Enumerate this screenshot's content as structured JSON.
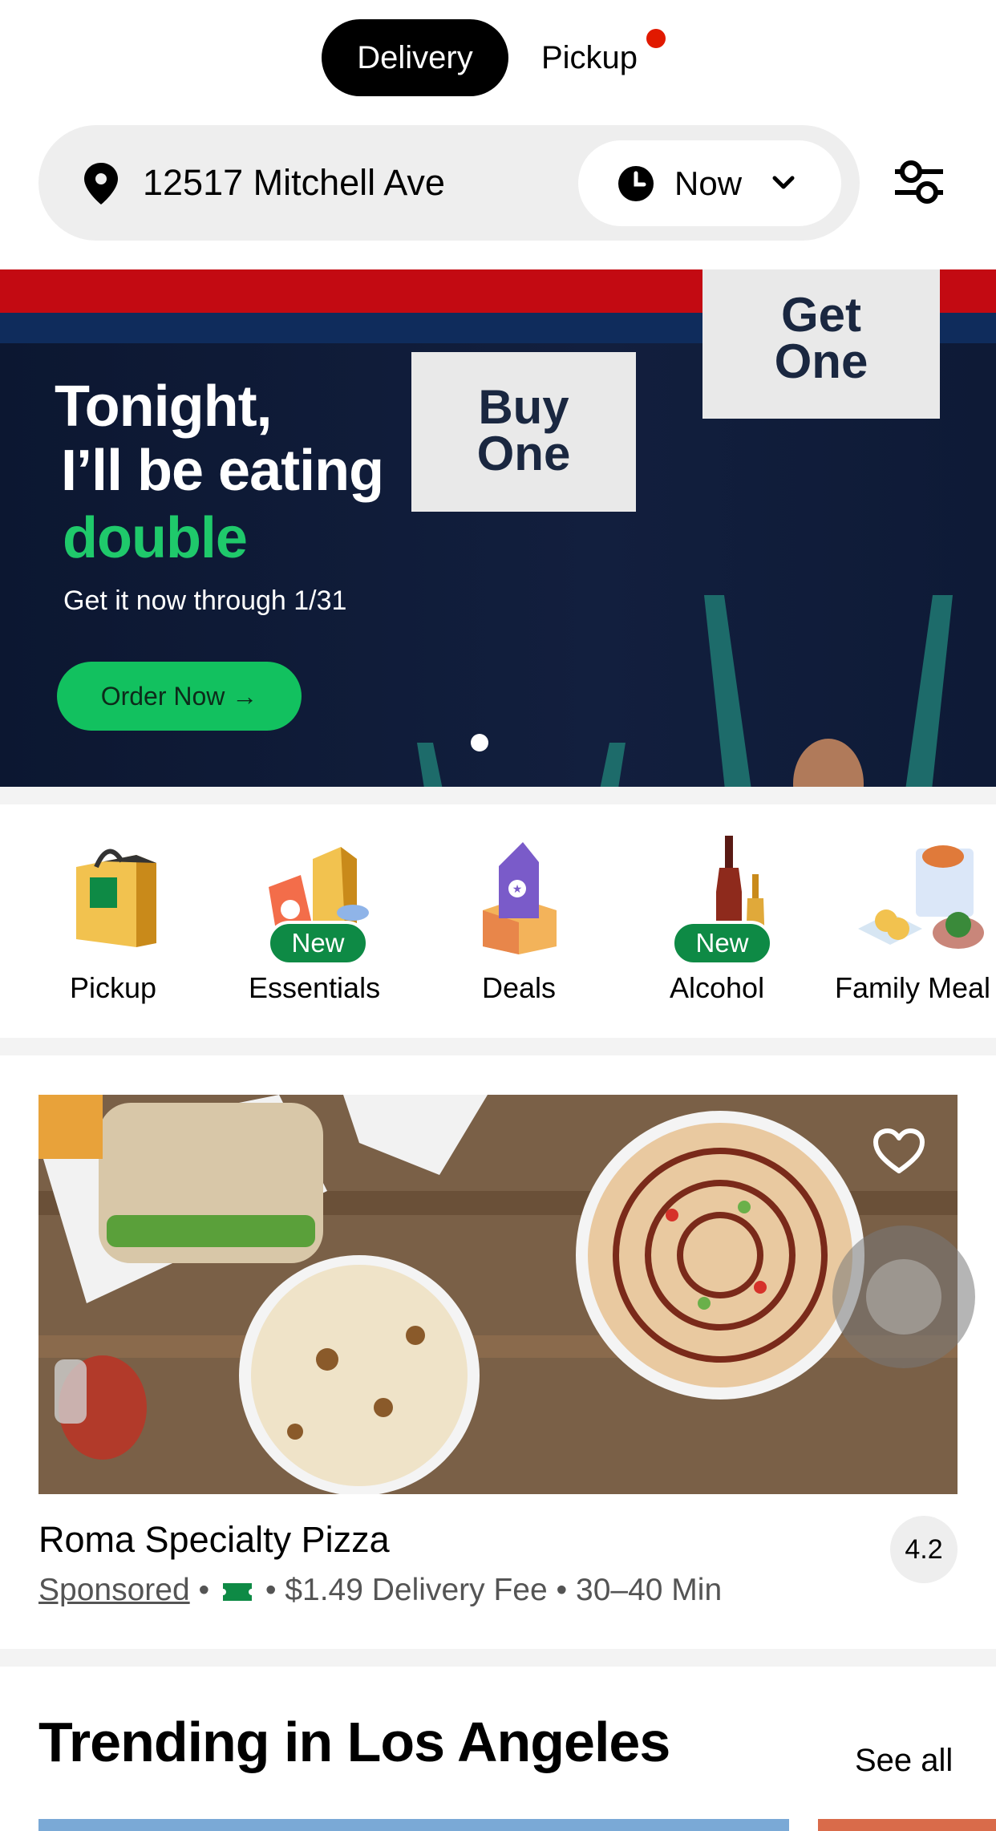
{
  "mode": {
    "delivery_label": "Delivery",
    "pickup_label": "Pickup",
    "active": "Delivery",
    "pickup_dot_color": "#e11900"
  },
  "location": {
    "address": "12517 Mitchell Ave",
    "time_label": "Now",
    "icons": [
      "location-pin-icon",
      "clock-icon",
      "chevron-down-icon",
      "filter-sliders-icon"
    ]
  },
  "banner": {
    "line1": "Tonight,",
    "line2": "I’ll be eating",
    "line3": "double",
    "subtitle": "Get it now through 1/31",
    "cta": "Order Now →",
    "sign_left": "Buy One",
    "sign_right": "Get One",
    "accent_color": "#1fc96b"
  },
  "categories": [
    {
      "label": "Pickup",
      "badge": ""
    },
    {
      "label": "Essentials",
      "badge": "New"
    },
    {
      "label": "Deals",
      "badge": ""
    },
    {
      "label": "Alcohol",
      "badge": "New"
    },
    {
      "label": "Family Meal",
      "badge": ""
    }
  ],
  "restaurant": {
    "name": "Roma Specialty Pizza",
    "sponsored": "Sponsored",
    "separator": "•",
    "fee": "$1.49 Delivery Fee",
    "time": "30–40 Min",
    "rating": "4.2"
  },
  "trending": {
    "title": "Trending in Los Angeles",
    "see_all": "See all"
  }
}
